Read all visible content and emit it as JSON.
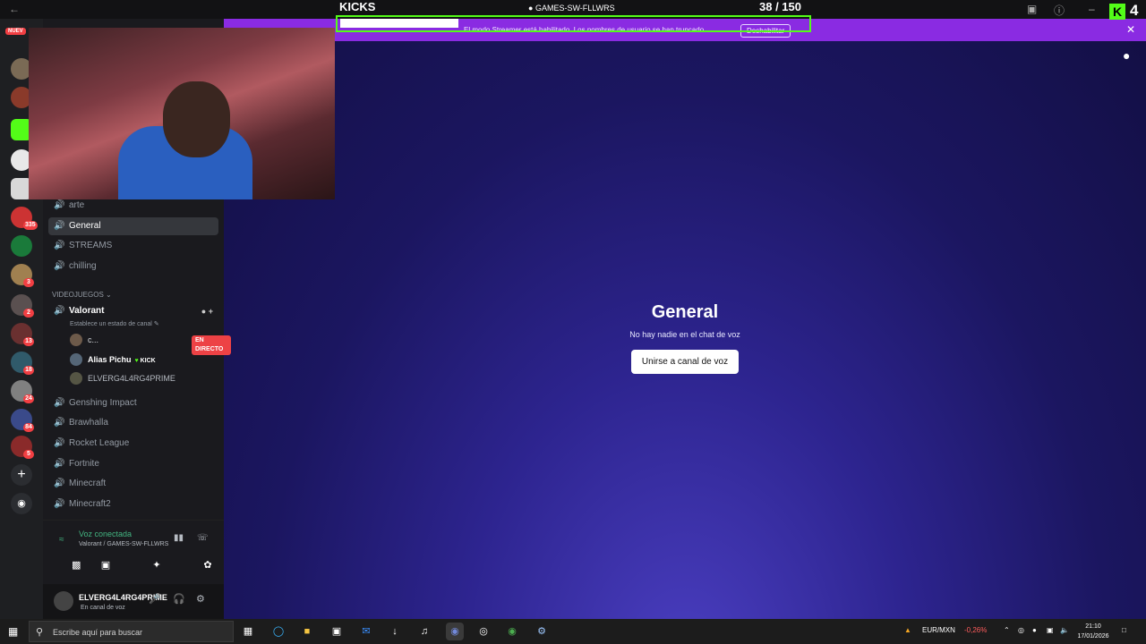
{
  "overlay": {
    "kicks_title": "KICKS",
    "kicks_count": "38  / 150",
    "channel_name": "GAMES-SW-FLLWRS",
    "kick_logo": "K",
    "kick_number": "4",
    "goal_progress": 0.253
  },
  "banner": {
    "text": "El modo Streamer está habilitado. Los nombres de usuario se han truncado.",
    "button": "Deshabilitar"
  },
  "rail": {
    "new_label": "NUEV",
    "badges": [
      "335",
      "3",
      "2",
      "13",
      "18",
      "24",
      "84",
      "5"
    ]
  },
  "channels": {
    "items_top": [
      {
        "name": "arte"
      },
      {
        "name": "General",
        "active": true
      },
      {
        "name": "STREAMS"
      },
      {
        "name": "chilling"
      }
    ],
    "category": "VIDEOJUEGOS",
    "voice_channel": "Valorant",
    "channel_status": "Establece un estado de canal",
    "users": [
      {
        "name": "c...",
        "live": "EN DIRECTO"
      },
      {
        "name": "Alias Pichu",
        "tag": "KICK"
      },
      {
        "name": "ELVERG4L4RG4PRIME"
      }
    ],
    "items_bottom": [
      {
        "name": "Genshing Impact"
      },
      {
        "name": "Brawhalla"
      },
      {
        "name": "Rocket League"
      },
      {
        "name": "Fortnite"
      },
      {
        "name": "Minecraft"
      },
      {
        "name": "Minecraft2"
      }
    ]
  },
  "voice_panel": {
    "title": "Voz conectada",
    "subtitle": "Valorant / GAMES-SW-FLLWRS"
  },
  "user_panel": {
    "name": "ELVERG4L4RG4PRIME",
    "status": "En canal de voz"
  },
  "main": {
    "title": "General",
    "subtitle": "No hay nadie en el chat de voz",
    "join_button": "Unirse a canal de voz"
  },
  "taskbar": {
    "search_placeholder": "Escribe aquí para buscar",
    "currency": "EUR/MXN",
    "currency_change": "-0,26%",
    "time": "21:10",
    "date": "17/01/2026"
  }
}
